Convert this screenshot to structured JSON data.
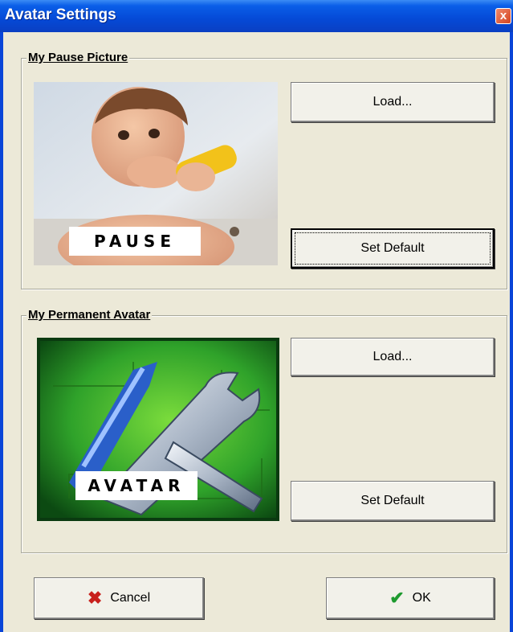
{
  "window": {
    "title": "Avatar Settings",
    "close_label": "x"
  },
  "pause_group": {
    "legend": "My Pause Picture",
    "image_label": "PAUSE",
    "load_label": "Load...",
    "default_label": "Set Default"
  },
  "avatar_group": {
    "legend": "My Permanent Avatar",
    "image_label": "AVATAR",
    "load_label": "Load...",
    "default_label": "Set Default"
  },
  "footer": {
    "cancel_label": "Cancel",
    "ok_label": "OK",
    "cancel_icon": "red-x-icon",
    "ok_icon": "green-check-icon"
  },
  "colors": {
    "title_bar": "#0549d6",
    "dialog_bg": "#ece9d8",
    "cancel_icon": "#c8201c",
    "ok_icon": "#1e9a2e"
  }
}
